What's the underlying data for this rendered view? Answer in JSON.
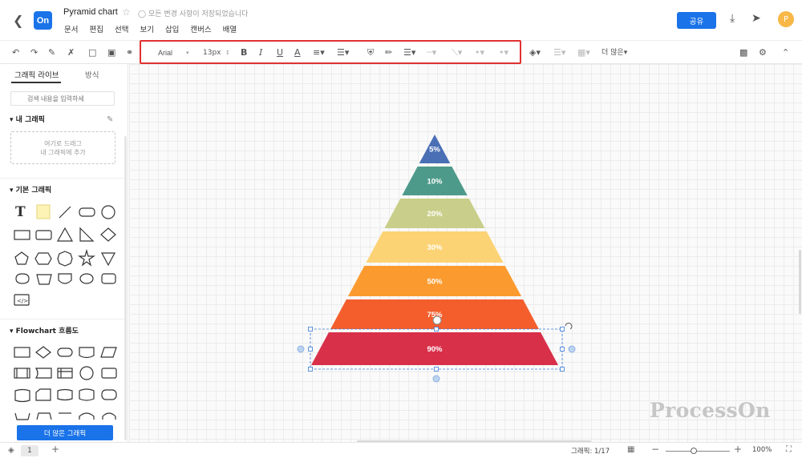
{
  "header": {
    "back_icon": "chevron-left-icon",
    "logo_text": "On",
    "title": "Pyramid chart",
    "saved_status": "모든 변경 사항이 저장되었습니다",
    "menu": [
      "문서",
      "편집",
      "선택",
      "보기",
      "삽입",
      "캔버스",
      "배열"
    ],
    "share_label": "공유",
    "avatar_letter": "P",
    "accent_color": "#1a73e8"
  },
  "toolbar": {
    "font_family": "Arial",
    "font_size": "13px",
    "more_label": "더 많은"
  },
  "left_panel": {
    "tabs": [
      "그래픽 라이브",
      "방식"
    ],
    "search_placeholder": "검색 내용을 입력하세",
    "my_graphics_title": "내 그래픽",
    "drop_line1": "여기로 드래그",
    "drop_line2": "내 그래픽에 추가",
    "basic_title": "기본 그래픽",
    "flowchart_title": "Flowchart 흐름도",
    "more_button": "더 많은 그래픽"
  },
  "pyramid": {
    "levels": [
      {
        "label": "5%",
        "color": "#4a6fb5"
      },
      {
        "label": "10%",
        "color": "#4e9a8a"
      },
      {
        "label": "20%",
        "color": "#c9cf8a"
      },
      {
        "label": "30%",
        "color": "#fcd374"
      },
      {
        "label": "50%",
        "color": "#fb9b2f"
      },
      {
        "label": "75%",
        "color": "#f45e2d"
      },
      {
        "label": "90%",
        "color": "#d9304a"
      }
    ]
  },
  "watermark": "ProcessOn",
  "status": {
    "page_number": "1",
    "graphics_count": "그래픽: 1/17",
    "zoom": "100%"
  }
}
